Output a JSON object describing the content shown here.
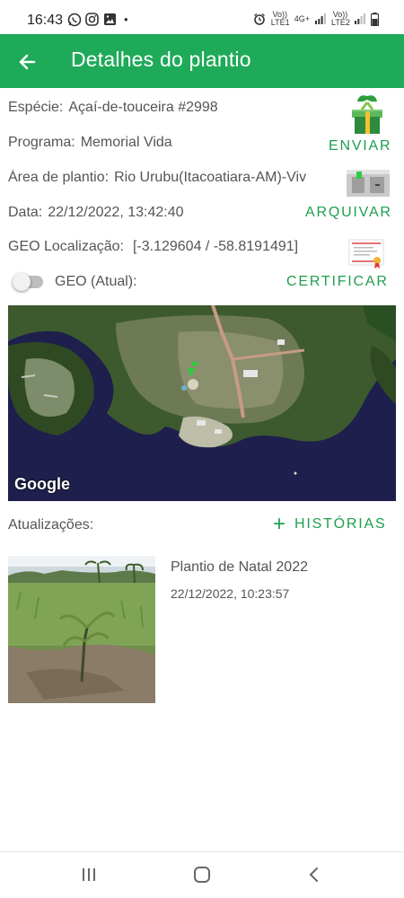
{
  "status_bar": {
    "time": "16:43",
    "dot": "•",
    "sim1": "Vo)) LTE1",
    "net": "4G+",
    "sim2": "Vo)) LTE2",
    "icons": [
      "whatsapp-icon",
      "instagram-icon",
      "gallery-icon",
      "alarm-icon",
      "signal-icon",
      "battery-icon"
    ]
  },
  "app_bar": {
    "title": "Detalhes do plantio"
  },
  "details": {
    "especie": {
      "label": "Espécie:",
      "value": "Açaí-de-touceira #2998"
    },
    "programa": {
      "label": "Programa:",
      "value": "Memorial Vida"
    },
    "area": {
      "label": "Área de plantio:",
      "value": "Rio Urubu(Itacoatiara-AM)-Viv"
    },
    "data": {
      "label": "Data:",
      "value": "22/12/2022, 13:42:40"
    },
    "geo": {
      "label": "GEO Localização:",
      "value": "[-3.129604 / -58.8191491]"
    },
    "geo_atual": {
      "label": "GEO (Atual):",
      "on": false
    }
  },
  "actions": {
    "enviar": "ENVIAR",
    "arquivar": "ARQUIVAR",
    "certificar": "CERTIFICAR"
  },
  "map": {
    "attribution": "Google"
  },
  "updates": {
    "label": "Atualizações:",
    "add_icon": "+",
    "histories_label": "HISTÓRIAS",
    "items": [
      {
        "title": "Plantio de Natal 2022",
        "date": "22/12/2022, 10:23:57"
      }
    ]
  },
  "colors": {
    "primary": "#1faa59",
    "accent_text": "#1e9e4e",
    "map_water": "#1e1f4c"
  }
}
